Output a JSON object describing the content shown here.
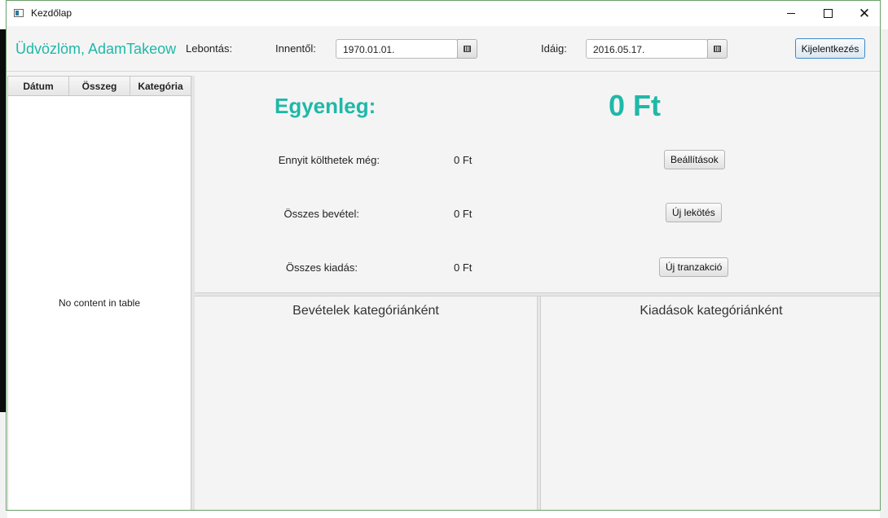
{
  "window": {
    "title": "Kezdőlap"
  },
  "toolbar": {
    "greeting": "Üdvözlöm, AdamTakeow",
    "breakdown_label": "Lebontás:",
    "from_label": "Innentől:",
    "from_value": "1970.01.01.",
    "to_label": "Idáig:",
    "to_value": "2016.05.17.",
    "logout_label": "Kijelentkezés"
  },
  "table": {
    "columns": [
      "Dátum",
      "Összeg",
      "Kategória"
    ],
    "empty_message": "No content in table"
  },
  "summary": {
    "balance_label": "Egyenleg:",
    "balance_value": "0 Ft",
    "rows": [
      {
        "label": "Ennyit költhetek még:",
        "value": "0 Ft",
        "button": "Beállítások"
      },
      {
        "label": "Összes bevétel:",
        "value": "0 Ft",
        "button": "Új lekötés"
      },
      {
        "label": "Összes kiadás:",
        "value": "0 Ft",
        "button": "Új tranzakció"
      }
    ]
  },
  "charts": {
    "income_title": "Bevételek kategóriánként",
    "expense_title": "Kiadások kategóriánként"
  },
  "colors": {
    "accent": "#1fb8a8"
  }
}
